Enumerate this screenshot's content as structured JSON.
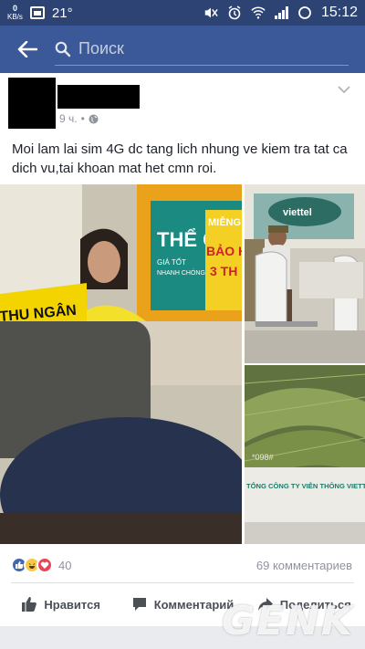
{
  "status_bar": {
    "kbs_value": "0",
    "kbs_unit": "KB/s",
    "temperature": "21°",
    "time": "15:12"
  },
  "nav": {
    "search_placeholder": "Поиск"
  },
  "post": {
    "time_ago": "9 ч.",
    "separator": "•",
    "text": "Moi lam lai sim 4G dc tang lich nhung ve kiem tra tat ca dich vu,tai khoan mat het cmn roi.",
    "photo1_sign_a": "THỂ C",
    "photo1_sign_b": "GIÁ TỐT",
    "photo1_sign_c": "NHANH CHÓNG",
    "photo1_sign_d": "MIỄNG",
    "photo1_sign_e": "BẢO HÀ",
    "photo1_sign_f": "3 TH",
    "photo1_counter": "THU NGÂN",
    "photo2_sign": "viettel",
    "photo3_code": "*098#",
    "photo3_caption": "TỔNG CÔNG TY VIỄN THÔNG VIETTEL",
    "reactions_count": "40",
    "comments_count": "69 комментариев"
  },
  "actions": {
    "like": "Нравится",
    "comment": "Комментарий",
    "share": "Поделиться"
  },
  "watermark": "GENK",
  "colors": {
    "facebook_blue": "#3b5998",
    "status_bar": "#2d4373",
    "like_blue": "#4267b2",
    "love_red": "#e9445a",
    "haha_yellow": "#f7c948"
  }
}
